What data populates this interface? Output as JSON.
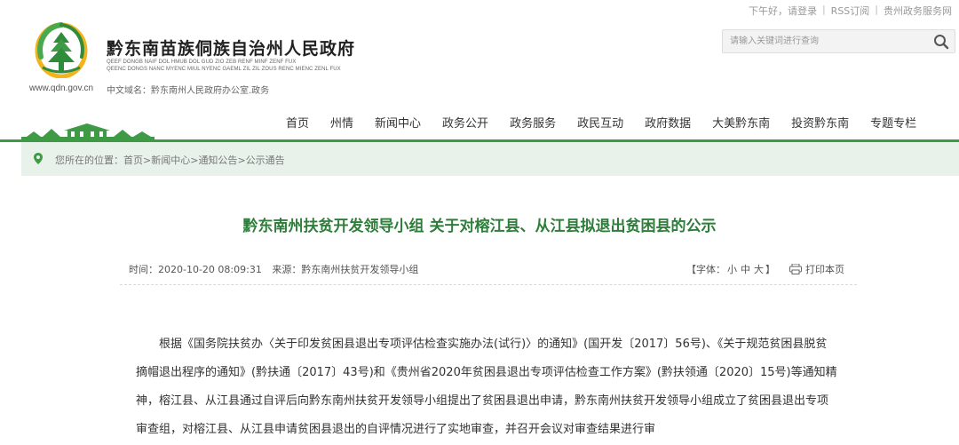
{
  "topbar": {
    "greeting": "下午好，请登录",
    "rss": "RSS订阅",
    "portal": "贵州政务服务网"
  },
  "header": {
    "site_title": "黔东南苗族侗族自治州人民政府",
    "subtitle_line1": "QEEF DONGB NAIF DOL HMUB DOL GUD ZIO ZEB RENF MINF ZENF FUX",
    "subtitle_line2": "QEENC DONGS NANC MYENC MIUL NYENC GAEML ZIL ZIL ZOUS RENC MIENC ZENL FUX",
    "domain_label": "中文域名：黔东南州人民政府办公室.政务",
    "url": "www.qdn.gov.cn"
  },
  "search": {
    "placeholder": "请输入关键词进行查询",
    "icon": "search-icon"
  },
  "nav": {
    "items": [
      {
        "label": "首页"
      },
      {
        "label": "州情"
      },
      {
        "label": "新闻中心"
      },
      {
        "label": "政务公开"
      },
      {
        "label": "政务服务"
      },
      {
        "label": "政民互动"
      },
      {
        "label": "政府数据"
      },
      {
        "label": "大美黔东南"
      },
      {
        "label": "投资黔东南"
      },
      {
        "label": "专题专栏"
      }
    ]
  },
  "breadcrumb": {
    "prefix": "您所在的位置：",
    "items": [
      {
        "label": "首页"
      },
      {
        "label": "新闻中心"
      },
      {
        "label": "通知公告"
      },
      {
        "label": "公示通告"
      }
    ],
    "separator": ">"
  },
  "article": {
    "title": "黔东南州扶贫开发领导小组 关于对榕江县、从江县拟退出贫困县的公示",
    "time": "时间：2020-10-20 08:09:31",
    "source": "来源：黔东南州扶贫开发领导小组",
    "font_size_label": "【字体：",
    "font_small": "小",
    "font_medium": "中",
    "font_large": "大",
    "font_size_end": "】",
    "print_label": "打印本页",
    "body": "根据《国务院扶贫办〈关于印发贫困县退出专项评估检查实施办法(试行)〉的通知》(国开发〔2017〕56号)、《关于规范贫困县脱贫摘帽退出程序的通知》(黔扶通〔2017〕43号)和《贵州省2020年贫困县退出专项评估检查工作方案》(黔扶领通〔2020〕15号)等通知精神，榕江县、从江县通过自评后向黔东南州扶贫开发领导小组提出了贫困县退出申请，黔东南州扶贫开发领导小组成立了贫困县退出专项审查组，对榕江县、从江县申请贫困县退出的自评情况进行了实地审查，并召开会议对审查结果进行审"
  },
  "colors": {
    "brand_green": "#3e9a44",
    "title_green": "#2e7d3a",
    "breadcrumb_bg": "#e8f2ea"
  }
}
